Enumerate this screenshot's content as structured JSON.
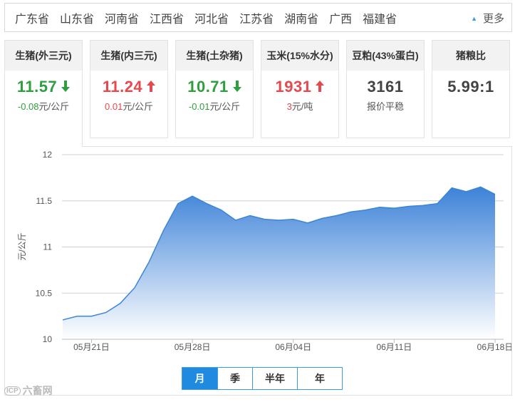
{
  "provinces": {
    "items": [
      "广东省",
      "山东省",
      "河南省",
      "江西省",
      "河北省",
      "江苏省",
      "湖南省",
      "广西",
      "福建省"
    ],
    "more_label": "更多"
  },
  "cards": [
    {
      "title": "生猪(外三元)",
      "price": "11.57",
      "trend": "down",
      "change_value": "-0.08",
      "change_unit": "元/公斤",
      "active": true
    },
    {
      "title": "生猪(内三元)",
      "price": "11.24",
      "trend": "up",
      "change_value": "0.01",
      "change_unit": "元/公斤",
      "active": false
    },
    {
      "title": "生猪(土杂猪)",
      "price": "10.71",
      "trend": "down",
      "change_value": "-0.01",
      "change_unit": "元/公斤",
      "active": false
    },
    {
      "title": "玉米(15%水分)",
      "price": "1931",
      "trend": "up",
      "change_value": "3",
      "change_unit": "元/吨",
      "active": false
    },
    {
      "title": "豆粕(43%蛋白)",
      "price": "3161",
      "trend": "neutral",
      "change_value": "",
      "change_unit": "报价平稳",
      "active": false
    },
    {
      "title": "猪粮比",
      "price": "5.99:1",
      "trend": "neutral",
      "change_value": "",
      "change_unit": "",
      "active": false
    }
  ],
  "period_tabs": [
    {
      "label": "月",
      "active": true
    },
    {
      "label": "季",
      "active": false
    },
    {
      "label": "半年",
      "active": false
    },
    {
      "label": "年",
      "active": false
    }
  ],
  "watermark": {
    "logo": "ICP",
    "text": "六畜网"
  },
  "chart_data": {
    "type": "area",
    "ylabel": "元/公斤",
    "ylim": [
      10,
      12
    ],
    "yticks": [
      "10",
      "10.5",
      "11",
      "11.5",
      "12"
    ],
    "xtick_labels": [
      "05月21日",
      "05月28日",
      "06月04日",
      "06月11日",
      "06月18日"
    ],
    "x": [
      "05-19",
      "05-20",
      "05-21",
      "05-22",
      "05-23",
      "05-24",
      "05-25",
      "05-26",
      "05-27",
      "05-28",
      "05-29",
      "05-30",
      "05-31",
      "06-01",
      "06-02",
      "06-03",
      "06-04",
      "06-05",
      "06-06",
      "06-07",
      "06-08",
      "06-09",
      "06-10",
      "06-11",
      "06-12",
      "06-13",
      "06-14",
      "06-15",
      "06-16",
      "06-17",
      "06-18"
    ],
    "series": [
      {
        "values": [
          10.21,
          10.25,
          10.25,
          10.29,
          10.39,
          10.56,
          10.84,
          11.18,
          11.47,
          11.55,
          11.47,
          11.4,
          11.29,
          11.34,
          11.3,
          11.29,
          11.3,
          11.26,
          11.31,
          11.34,
          11.38,
          11.4,
          11.43,
          11.42,
          11.44,
          11.45,
          11.47,
          11.64,
          11.6,
          11.65,
          11.57
        ]
      }
    ],
    "colors": {
      "line": "#3a86d4",
      "fill_top": "#3d82d8",
      "fill_bottom": "#ffffff",
      "grid": "#d0d0d0"
    },
    "grid": true
  }
}
